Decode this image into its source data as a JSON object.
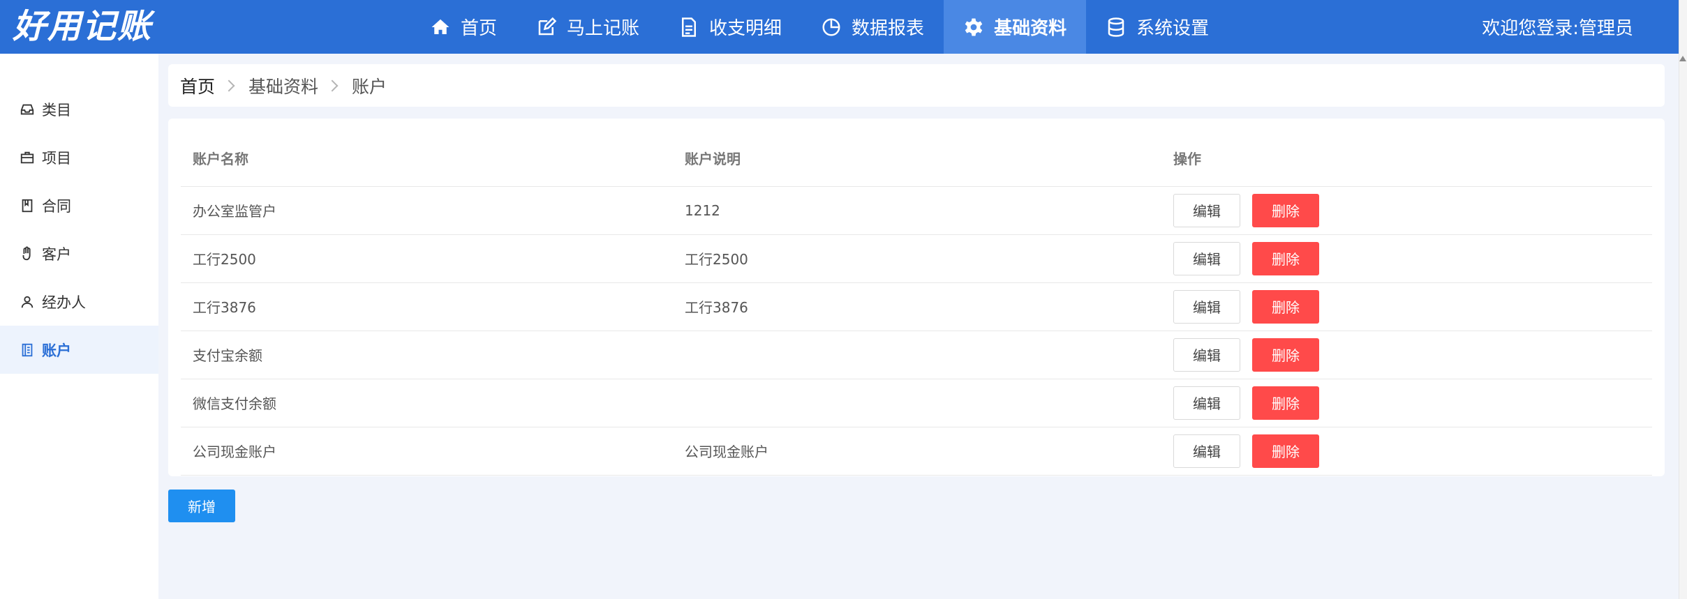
{
  "app": {
    "logo": "好用记账"
  },
  "nav": [
    {
      "label": "首页",
      "icon": "home-icon",
      "active": false
    },
    {
      "label": "马上记账",
      "icon": "edit-icon",
      "active": false
    },
    {
      "label": "收支明细",
      "icon": "document-icon",
      "active": false
    },
    {
      "label": "数据报表",
      "icon": "pie-chart-icon",
      "active": false
    },
    {
      "label": "基础资料",
      "icon": "gear-icon",
      "active": true
    },
    {
      "label": "系统设置",
      "icon": "database-icon",
      "active": false
    }
  ],
  "header": {
    "welcome": "欢迎您登录:管理员"
  },
  "sidebar": {
    "items": [
      {
        "label": "类目",
        "icon": "inbox-icon",
        "active": false
      },
      {
        "label": "项目",
        "icon": "briefcase-icon",
        "active": false
      },
      {
        "label": "合同",
        "icon": "book-icon",
        "active": false
      },
      {
        "label": "客户",
        "icon": "hand-icon",
        "active": false
      },
      {
        "label": "经办人",
        "icon": "user-icon",
        "active": false
      },
      {
        "label": "账户",
        "icon": "notebook-icon",
        "active": true
      }
    ]
  },
  "breadcrumb": {
    "items": [
      "首页",
      "基础资料",
      "账户"
    ]
  },
  "table": {
    "headers": {
      "name": "账户名称",
      "desc": "账户说明",
      "ops": "操作"
    },
    "edit_label": "编辑",
    "delete_label": "删除",
    "rows": [
      {
        "name": "办公室监管户",
        "desc": "1212"
      },
      {
        "name": "工行2500",
        "desc": "工行2500"
      },
      {
        "name": "工行3876",
        "desc": "工行3876"
      },
      {
        "name": "支付宝余额",
        "desc": ""
      },
      {
        "name": "微信支付余额",
        "desc": ""
      },
      {
        "name": "公司现金账户",
        "desc": "公司现金账户"
      }
    ]
  },
  "actions": {
    "add_label": "新增"
  },
  "colors": {
    "primary": "#2b6fd6",
    "danger": "#ff4a4a",
    "add": "#1f8ff0"
  }
}
